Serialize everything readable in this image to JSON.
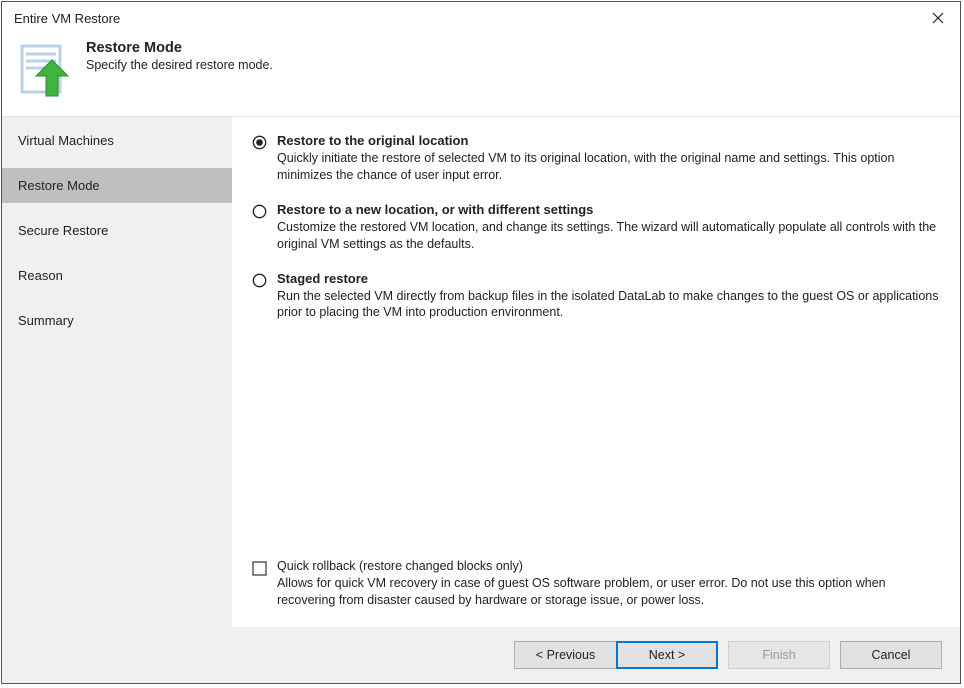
{
  "window": {
    "title": "Entire VM Restore"
  },
  "header": {
    "title": "Restore Mode",
    "subtitle": "Specify the desired restore mode."
  },
  "sidebar": {
    "steps": [
      {
        "label": "Virtual Machines",
        "active": false
      },
      {
        "label": "Restore Mode",
        "active": true
      },
      {
        "label": "Secure Restore",
        "active": false
      },
      {
        "label": "Reason",
        "active": false
      },
      {
        "label": "Summary",
        "active": false
      }
    ]
  },
  "options": [
    {
      "selected": true,
      "title": "Restore to the original location",
      "desc": "Quickly initiate the restore of selected VM to its original location, with the original name and settings. This option minimizes the chance of user input error."
    },
    {
      "selected": false,
      "title": "Restore to a new location, or with different settings",
      "desc": "Customize the restored VM location, and change its settings. The wizard will automatically populate all controls with the original VM settings as the defaults."
    },
    {
      "selected": false,
      "title": "Staged restore",
      "desc": "Run the selected VM directly from backup files in the isolated DataLab to make changes to the guest OS or applications prior to placing the VM into production environment."
    }
  ],
  "quickRollback": {
    "checked": false,
    "title": "Quick rollback (restore changed blocks only)",
    "desc": "Allows for quick VM recovery in case of guest OS software problem, or user error. Do not use this option when recovering from disaster caused by hardware or storage issue, or power loss."
  },
  "buttons": {
    "previous": "< Previous",
    "next": "Next >",
    "finish": "Finish",
    "cancel": "Cancel"
  }
}
